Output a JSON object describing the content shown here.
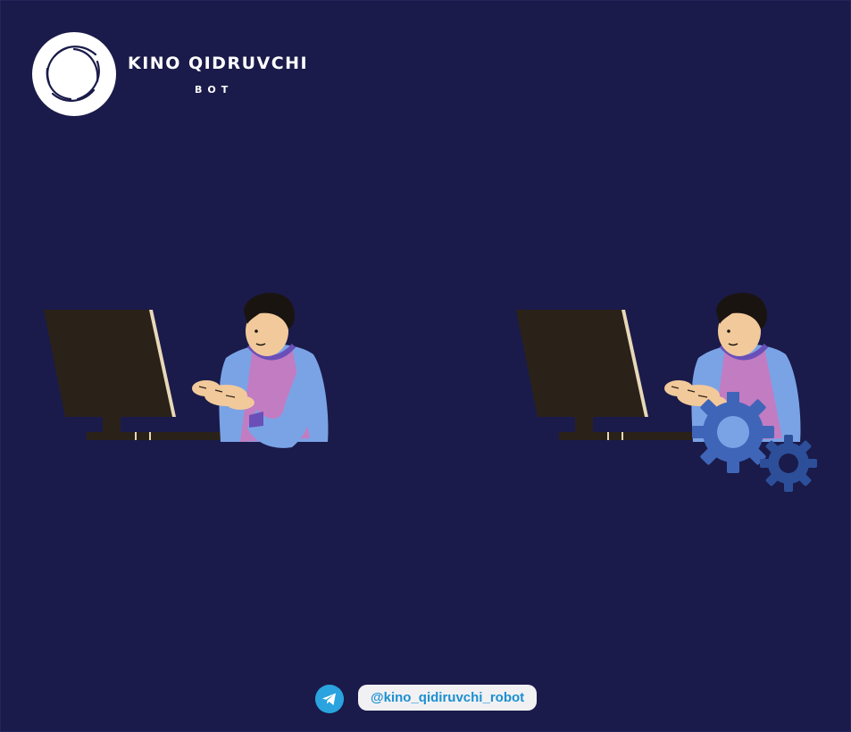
{
  "brand": {
    "title": "KINO QIDRUVCHI",
    "subtitle": "BOT",
    "logo_icon": "camera-shutter-aperture-icon"
  },
  "footer": {
    "platform_icon": "telegram-icon",
    "handle": "@kino_qidiruvchi_robot"
  },
  "illustrations": [
    {
      "name": "person-at-computer",
      "icon": "person-typing-illustration"
    },
    {
      "name": "person-at-computer-with-gears",
      "icon": "gear-icon"
    }
  ],
  "colors": {
    "background": "#1a1b4a",
    "text": "#ffffff",
    "sweater": "#7aa3e6",
    "shirt": "#c27cc2",
    "gear": "#3f65b8",
    "telegram": "#2aa3df",
    "handle_text": "#1c8fd0"
  }
}
